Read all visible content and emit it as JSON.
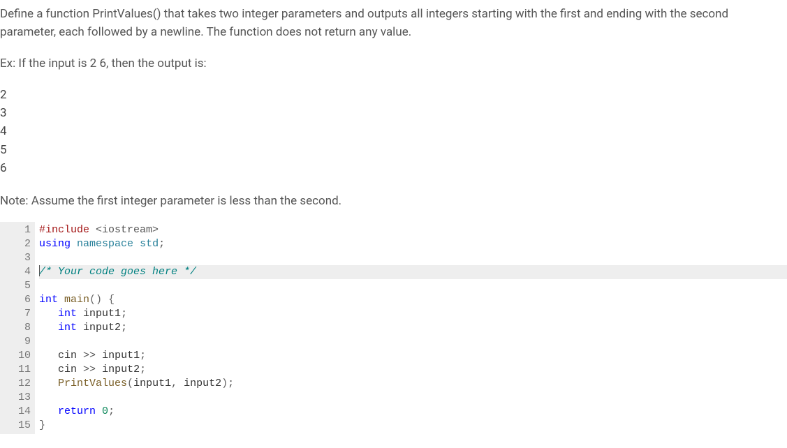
{
  "problem": {
    "description": "Define a function PrintValues() that takes two integer parameters and outputs all integers starting with the first and ending with the second parameter, each followed by a newline. The function does not return any value.",
    "example_label": "Ex: If the input is 2 6, then the output is:",
    "example_output": "2\n3\n4\n5\n6",
    "note": "Note: Assume the first integer parameter is less than the second."
  },
  "code": {
    "line_count": 15,
    "highlight_line": 4,
    "lines": {
      "l1": {
        "include": "#include",
        "header": "<iostream>"
      },
      "l2": {
        "using": "using",
        "namespace": "namespace",
        "std": "std",
        "semi": ";"
      },
      "l4": {
        "comment": "/* Your code goes here */"
      },
      "l6": {
        "int": "int",
        "main": "main",
        "parens": "()",
        "brace": " {"
      },
      "l7": {
        "int": "int",
        "var": "input1",
        "semi": ";"
      },
      "l8": {
        "int": "int",
        "var": "input2",
        "semi": ";"
      },
      "l10": {
        "cin": "cin",
        "op": ">>",
        "var": "input1",
        "semi": ";"
      },
      "l11": {
        "cin": "cin",
        "op": ">>",
        "var": "input2",
        "semi": ";"
      },
      "l12": {
        "fn": "PrintValues",
        "open": "(",
        "arg1": "input1",
        "comma": ", ",
        "arg2": "input2",
        "close": ")",
        "semi": ";"
      },
      "l14": {
        "return": "return",
        "zero": "0",
        "semi": ";"
      },
      "l15": {
        "brace": "}"
      }
    }
  }
}
